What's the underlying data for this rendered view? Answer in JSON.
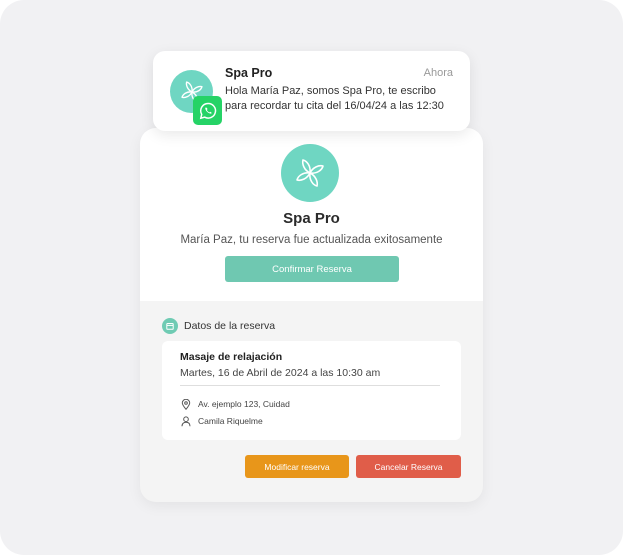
{
  "colors": {
    "accent": "#6fcbb3",
    "brand_logo_bg": "#6fd6c2",
    "confirm_button": "#6fc8b1",
    "modify_button": "#e8961a",
    "cancel_button": "#e05d49",
    "whatsapp": "#25d366"
  },
  "notification": {
    "sender": "Spa Pro",
    "time": "Ahora",
    "message_line1": "Hola María Paz, somos Spa Pro, te escribo",
    "message_line2": "para recordar tu cita del 16/04/24 a las 12:30",
    "avatar_icon": "lotus-icon",
    "badge_icon": "whatsapp-icon"
  },
  "card": {
    "brand_icon": "lotus-icon",
    "brand_name": "Spa Pro",
    "message": "María Paz, tu reserva fue actualizada exitosamente",
    "confirm_label": "Confirmar Reserva",
    "section": {
      "icon": "calendar-icon",
      "title": "Datos de la reserva"
    },
    "details": {
      "service": "Masaje de relajación",
      "datetime": "Martes, 16 de Abril de 2024 a las 10:30 am",
      "address_icon": "location-pin-icon",
      "address": "Av. ejemplo 123, Cuidad",
      "staff_icon": "person-icon",
      "staff": "Camila Riquelme"
    },
    "modify_label": "Modificar reserva",
    "cancel_label": "Cancelar Reserva"
  }
}
